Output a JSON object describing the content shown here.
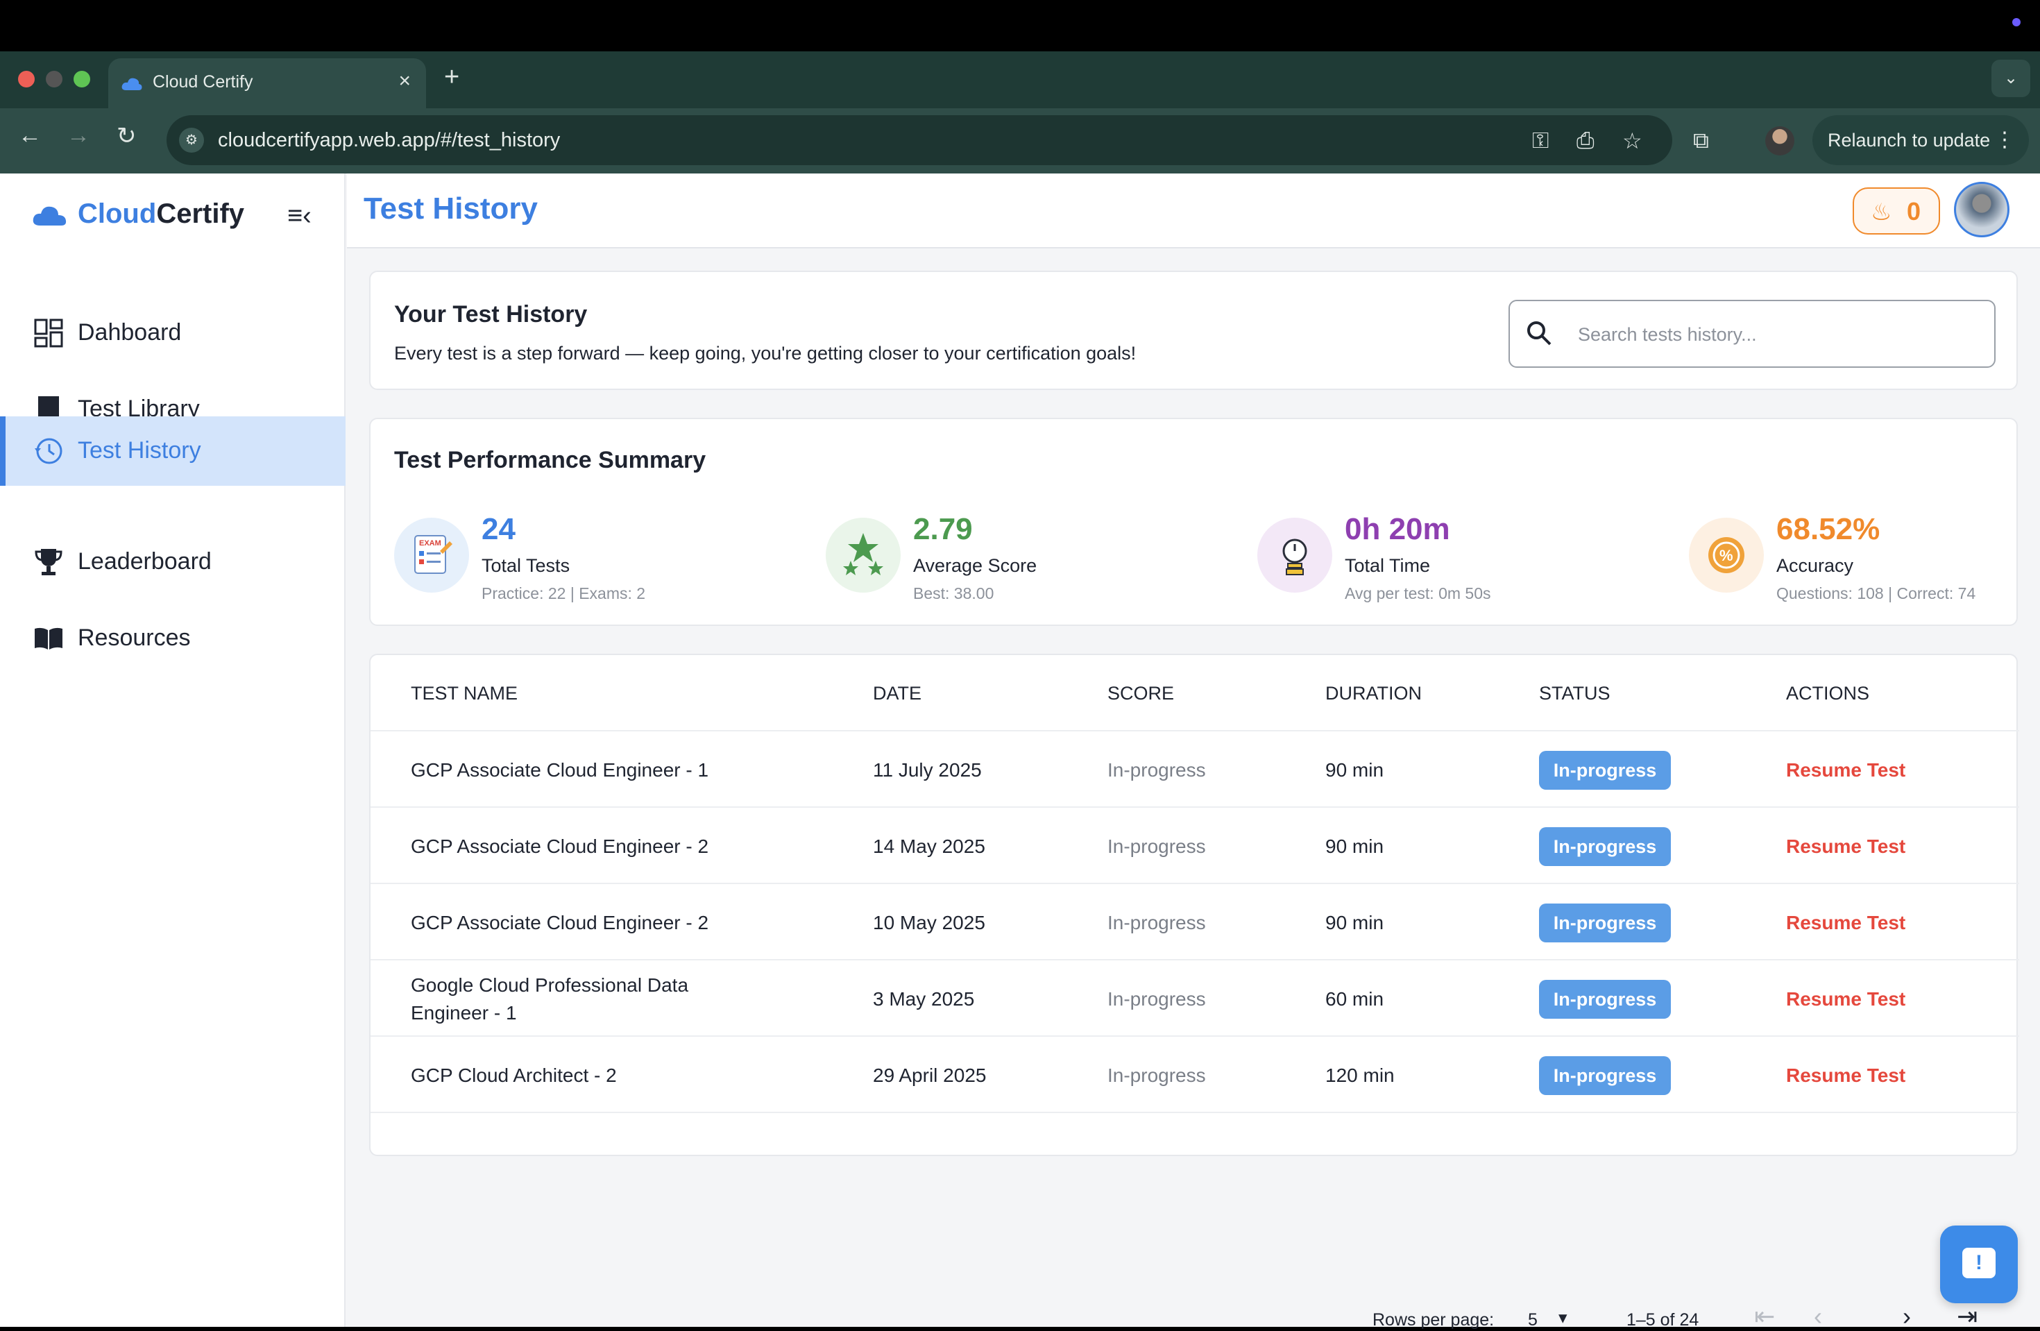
{
  "browser": {
    "tab_title": "Cloud Certify",
    "url": "cloudcertifyapp.web.app/#/test_history",
    "relaunch_label": "Relaunch to update"
  },
  "brand": {
    "part1": "Cloud",
    "part2": "Certify"
  },
  "sidebar": {
    "items": [
      {
        "label": "Dahboard",
        "icon": "dashboard-icon",
        "active": false
      },
      {
        "label": "Test Library",
        "icon": "book-icon",
        "active": false
      },
      {
        "label": "Test History",
        "icon": "history-icon",
        "active": true
      },
      {
        "label": "Leaderboard",
        "icon": "trophy-icon",
        "active": false
      },
      {
        "label": "Resources",
        "icon": "open-book-icon",
        "active": false
      }
    ]
  },
  "header": {
    "title": "Test History",
    "streak_count": "0"
  },
  "intro": {
    "heading": "Your Test History",
    "subtext": "Every test is a step forward — keep going, you're getting closer to your certification goals!",
    "search_placeholder": "Search tests history..."
  },
  "summary": {
    "heading": "Test Performance Summary",
    "stats": [
      {
        "value": "24",
        "label": "Total Tests",
        "detail": "Practice: 22 | Exams: 2",
        "color": "#3d7fe0",
        "icon": "exam-icon"
      },
      {
        "value": "2.79",
        "label": "Average Score",
        "detail": "Best: 38.00",
        "color": "#4c9a4f",
        "icon": "stars-icon"
      },
      {
        "value": "0h 20m",
        "label": "Total Time",
        "detail": "Avg per test: 0m 50s",
        "color": "#8e3fb0",
        "icon": "stopwatch-icon"
      },
      {
        "value": "68.52%",
        "label": "Accuracy",
        "detail": "Questions: 108 | Correct: 74",
        "color": "#f08a2c",
        "icon": "percent-badge-icon"
      }
    ]
  },
  "table": {
    "headers": [
      "TEST NAME",
      "DATE",
      "SCORE",
      "DURATION",
      "STATUS",
      "ACTIONS"
    ],
    "rows": [
      {
        "name": "GCP Associate Cloud Engineer - 1",
        "date": "11 July 2025",
        "score": "In-progress",
        "duration": "90 min",
        "status": "In-progress",
        "action": "Resume Test"
      },
      {
        "name": "GCP Associate Cloud Engineer - 2",
        "date": "14 May 2025",
        "score": "In-progress",
        "duration": "90 min",
        "status": "In-progress",
        "action": "Resume Test"
      },
      {
        "name": "GCP Associate Cloud Engineer - 2",
        "date": "10 May 2025",
        "score": "In-progress",
        "duration": "90 min",
        "status": "In-progress",
        "action": "Resume Test"
      },
      {
        "name_line1": "Google Cloud Professional Data",
        "name_line2": "Engineer - 1",
        "date": "3 May 2025",
        "score": "In-progress",
        "duration": "60 min",
        "status": "In-progress",
        "action": "Resume Test"
      },
      {
        "name": "GCP Cloud Architect - 2",
        "date": "29 April 2025",
        "score": "In-progress",
        "duration": "120 min",
        "status": "In-progress",
        "action": "Resume Test"
      }
    ],
    "pagination": {
      "rows_per_page_label": "Rows per page:",
      "rows_per_page": "5",
      "range": "1–5 of 24"
    }
  },
  "colors": {
    "accent": "#3d7fe0",
    "danger": "#e5483d",
    "badge": "#5b9de6",
    "streak": "#f08a2c"
  }
}
